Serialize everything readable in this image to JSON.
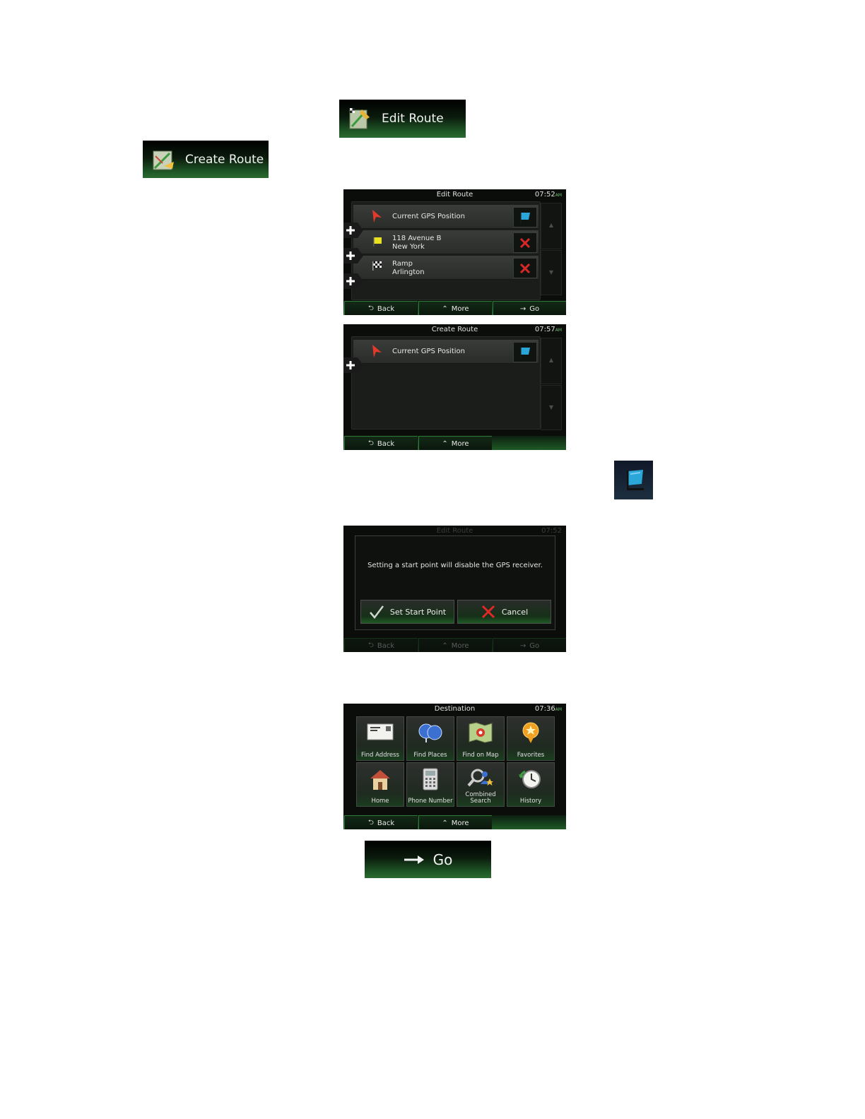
{
  "edit_route_button": {
    "label": "Edit Route",
    "icon": "edit-route-icon"
  },
  "create_route_button": {
    "label": "Create Route",
    "icon": "create-route-icon"
  },
  "edit_route_screen": {
    "title": "Edit Route",
    "time": "07:52",
    "ampm": "AM",
    "rows": [
      {
        "line1": "Current GPS Position",
        "line2": "",
        "icon": "gps-arrow-icon",
        "action_icon": "flag-icon"
      },
      {
        "line1": "118 Avenue B",
        "line2": "New York",
        "icon": "yellow-flag-icon",
        "action_icon": "delete-x-icon"
      },
      {
        "line1": "Ramp",
        "line2": "Arlington",
        "icon": "checkered-flag-icon",
        "action_icon": "delete-x-icon"
      }
    ],
    "bottom": {
      "back": "Back",
      "more": "More",
      "go": "Go"
    }
  },
  "create_route_screen": {
    "title": "Create Route",
    "time": "07:57",
    "ampm": "AM",
    "rows": [
      {
        "line1": "Current GPS Position",
        "icon": "gps-arrow-icon",
        "action_icon": "flag-icon"
      }
    ],
    "bottom": {
      "back": "Back",
      "more": "More"
    }
  },
  "start_flag_button": {
    "icon": "flag-icon"
  },
  "dialog_screen": {
    "bg_title": "Edit Route",
    "bg_time": "07:52",
    "message": "Setting a start point will disable the GPS receiver.",
    "confirm": "Set Start Point",
    "cancel": "Cancel",
    "bottom": {
      "back": "Back",
      "more": "More",
      "go": "Go"
    }
  },
  "destination_screen": {
    "title": "Destination",
    "time": "07:36",
    "ampm": "AM",
    "tiles": [
      {
        "label": "Find Address",
        "icon": "envelope-icon"
      },
      {
        "label": "Find Places",
        "icon": "places-icon"
      },
      {
        "label": "Find on Map",
        "icon": "map-icon"
      },
      {
        "label": "Favorites",
        "icon": "star-pin-icon"
      },
      {
        "label": "Home",
        "icon": "house-icon"
      },
      {
        "label": "Phone Number",
        "icon": "phone-icon"
      },
      {
        "label": "Combined Search",
        "icon": "search-person-icon"
      },
      {
        "label": "History",
        "icon": "clock-icon"
      }
    ],
    "bottom": {
      "back": "Back",
      "more": "More"
    }
  },
  "go_button": {
    "label": "Go",
    "icon": "arrow-right-icon"
  },
  "colors": {
    "accent_green": "#1f5a25",
    "delete_red": "#d62828",
    "flag_blue": "#2aa6d8"
  }
}
